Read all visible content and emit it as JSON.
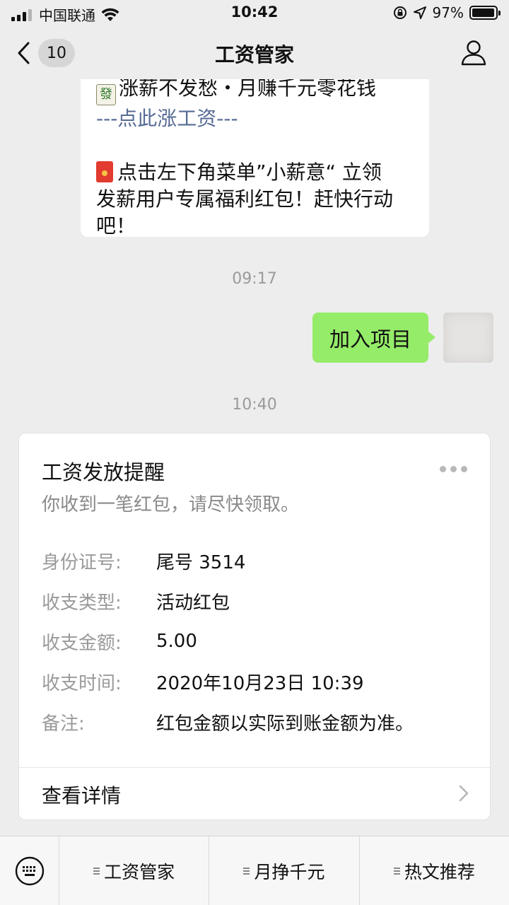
{
  "status_bar": {
    "carrier": "中国联通",
    "time": "10:42",
    "battery_percent": "97%",
    "battery_level": 0.97
  },
  "nav": {
    "unread_count": "10",
    "title": "工资管家"
  },
  "chat": {
    "incoming_message": {
      "line1": "涨薪不发愁・月赚千元零花钱",
      "link": "---点此涨工资---",
      "line2": "点击左下角菜单”小薪意“ 立领",
      "line3": "发薪用户专属福利红包！赶快行动",
      "line4": "吧！"
    },
    "timestamp_1": "09:17",
    "outgoing_message": "加入项目",
    "timestamp_2": "10:40",
    "card": {
      "title": "工资发放提醒",
      "subtitle": "你收到一笔红包，请尽快领取。",
      "fields": [
        {
          "label": "身份证号:",
          "value": "尾号 3514"
        },
        {
          "label": "收支类型:",
          "value": "活动红包"
        },
        {
          "label": "收支金额:",
          "value": "5.00"
        },
        {
          "label": "收支时间:",
          "value": "2020年10月23日 10:39"
        },
        {
          "label": "备注:",
          "value": "红包金额以实际到账金额为准。"
        }
      ],
      "footer_label": "查看详情"
    }
  },
  "bottom_menu": {
    "items": [
      {
        "label": "工资管家"
      },
      {
        "label": "月挣千元"
      },
      {
        "label": "热文推荐"
      }
    ]
  },
  "colors": {
    "background": "#ededed",
    "outgoing_bubble": "#95ec69",
    "link": "#576b95"
  }
}
